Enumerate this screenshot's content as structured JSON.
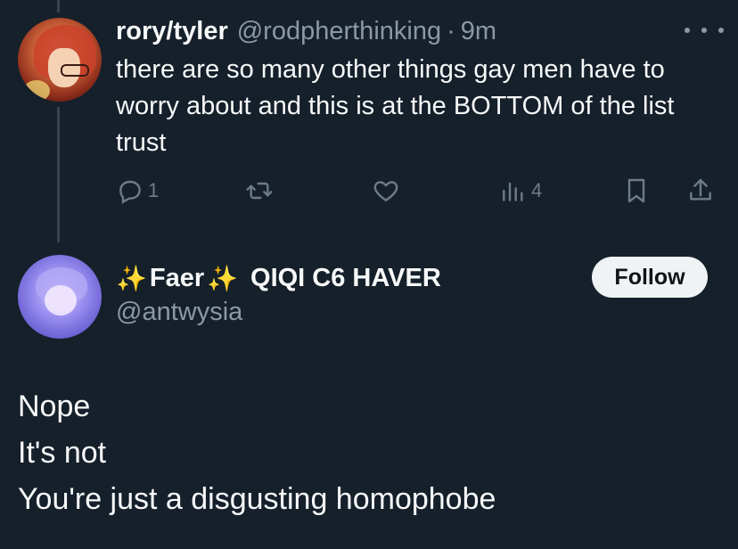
{
  "parent_tweet": {
    "display_name": "rory/tyler",
    "handle": "@rodpherthinking",
    "separator": "·",
    "time": "9m",
    "text": "there are so many other things gay men have to worry about and this is at the BOTTOM of the list trust",
    "actions": {
      "reply_count": "1",
      "retweet_count": "",
      "like_count": "",
      "views_count": "4"
    },
    "icons": [
      "reply-icon",
      "retweet-icon",
      "like-icon",
      "views-icon",
      "bookmark-icon",
      "share-icon",
      "more-icon"
    ]
  },
  "reply_tweet": {
    "sparkle_left": "✨",
    "display_name": "Faer",
    "sparkle_right": "✨",
    "name_suffix": "QIQI C6 HAVER",
    "handle": "@antwysia",
    "follow_label": "Follow",
    "text_lines": [
      "Nope",
      "It's not",
      "You're just a disgusting homophobe"
    ]
  },
  "colors": {
    "background": "#15202b",
    "text_primary": "#f7f9f9",
    "text_secondary": "#8b98a5",
    "icon": "#6e7b88",
    "thread_line": "#38444d",
    "follow_bg": "#eff3f4",
    "sparkle": "#f5c518"
  }
}
